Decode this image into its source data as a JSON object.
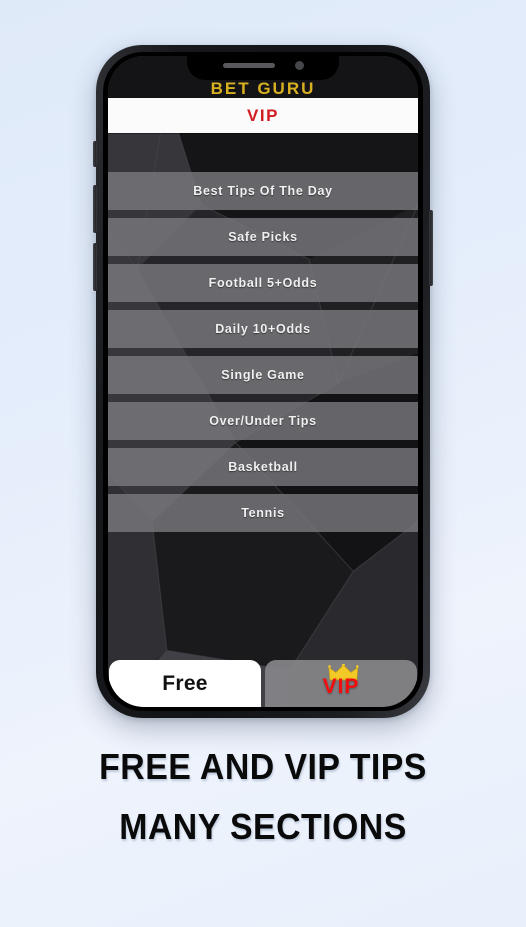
{
  "page": {
    "background_color": "#e4edfb",
    "caption_color": "#0a0a0a"
  },
  "device": {
    "frame_color": "#17181b",
    "notch": {
      "speaker_icon": "speaker-slot-icon",
      "camera_icon": "front-camera-icon"
    },
    "side_buttons": {
      "silent_switch": "silent-switch",
      "volume_up": "volume-up-button",
      "volume_down": "volume-down-button",
      "power": "power-button"
    }
  },
  "app": {
    "brand_title": "BET GURU",
    "brand_color": "#d9b021",
    "header": {
      "label": "VIP",
      "label_color": "#d01d22",
      "background_color": "#fbfbfb"
    },
    "tips_list": [
      {
        "label": "Best Tips Of The Day"
      },
      {
        "label": "Safe Picks"
      },
      {
        "label": "Football 5+Odds"
      },
      {
        "label": "Daily 10+Odds"
      },
      {
        "label": "Single Game"
      },
      {
        "label": "Over/Under Tips"
      },
      {
        "label": "Basketball"
      },
      {
        "label": "Tennis"
      }
    ],
    "tabbar": {
      "tabs": [
        {
          "label": "Free",
          "state": "active",
          "text_color": "#111111",
          "background_color": "#ffffff"
        },
        {
          "label": "VIP",
          "state": "inactive",
          "text_color": "#f30d0d",
          "background_color": "#858589",
          "icon": "crown-icon",
          "icon_color": "#f2c927"
        }
      ]
    }
  },
  "captions": {
    "line1": "FREE AND VIP TIPS",
    "line2": "MANY SECTIONS"
  }
}
